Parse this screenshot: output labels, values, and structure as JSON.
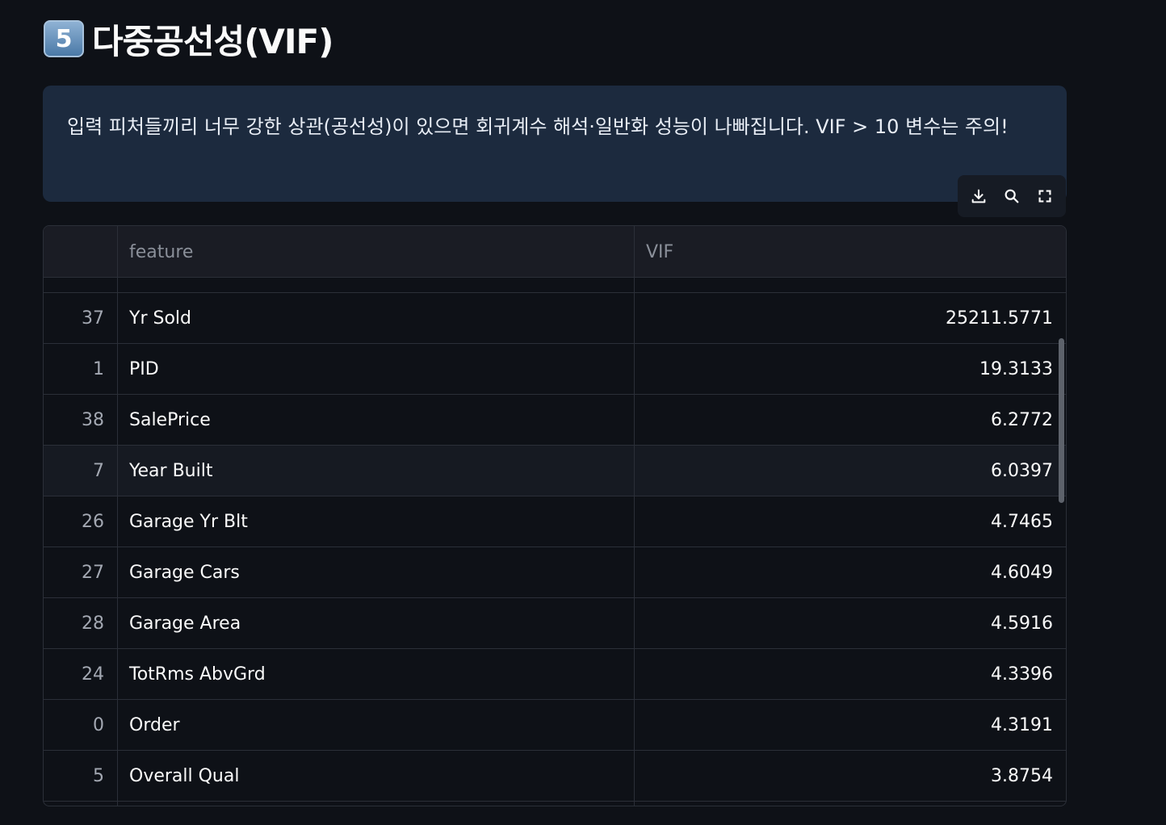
{
  "heading": {
    "badge": "5",
    "title": "다중공선성(VIF)"
  },
  "info": {
    "text": "입력 피처들끼리 너무 강한 상관(공선성)이 있으면 회귀계수 해석·일반화 성능이 나빠집니다. VIF > 10 변수는 주의!"
  },
  "toolbar": {
    "download_icon": "download-icon",
    "search_icon": "search-icon",
    "fullscreen_icon": "fullscreen-icon"
  },
  "table": {
    "columns": [
      "",
      "feature",
      "VIF"
    ],
    "rows": [
      {
        "index": "37",
        "feature": "Yr Sold",
        "vif": "25211.5771"
      },
      {
        "index": "1",
        "feature": "PID",
        "vif": "19.3133"
      },
      {
        "index": "38",
        "feature": "SalePrice",
        "vif": "6.2772"
      },
      {
        "index": "7",
        "feature": "Year Built",
        "vif": "6.0397"
      },
      {
        "index": "26",
        "feature": "Garage Yr Blt",
        "vif": "4.7465"
      },
      {
        "index": "27",
        "feature": "Garage Cars",
        "vif": "4.6049"
      },
      {
        "index": "28",
        "feature": "Garage Area",
        "vif": "4.5916"
      },
      {
        "index": "24",
        "feature": "TotRms AbvGrd",
        "vif": "4.3396"
      },
      {
        "index": "0",
        "feature": "Order",
        "vif": "4.3191"
      },
      {
        "index": "5",
        "feature": "Overall Qual",
        "vif": "3.8754"
      }
    ]
  },
  "colors": {
    "background": "#0e1117",
    "info_bg": "#1c2a3e",
    "header_bg": "#1a1c24",
    "border": "#2b2f38"
  }
}
